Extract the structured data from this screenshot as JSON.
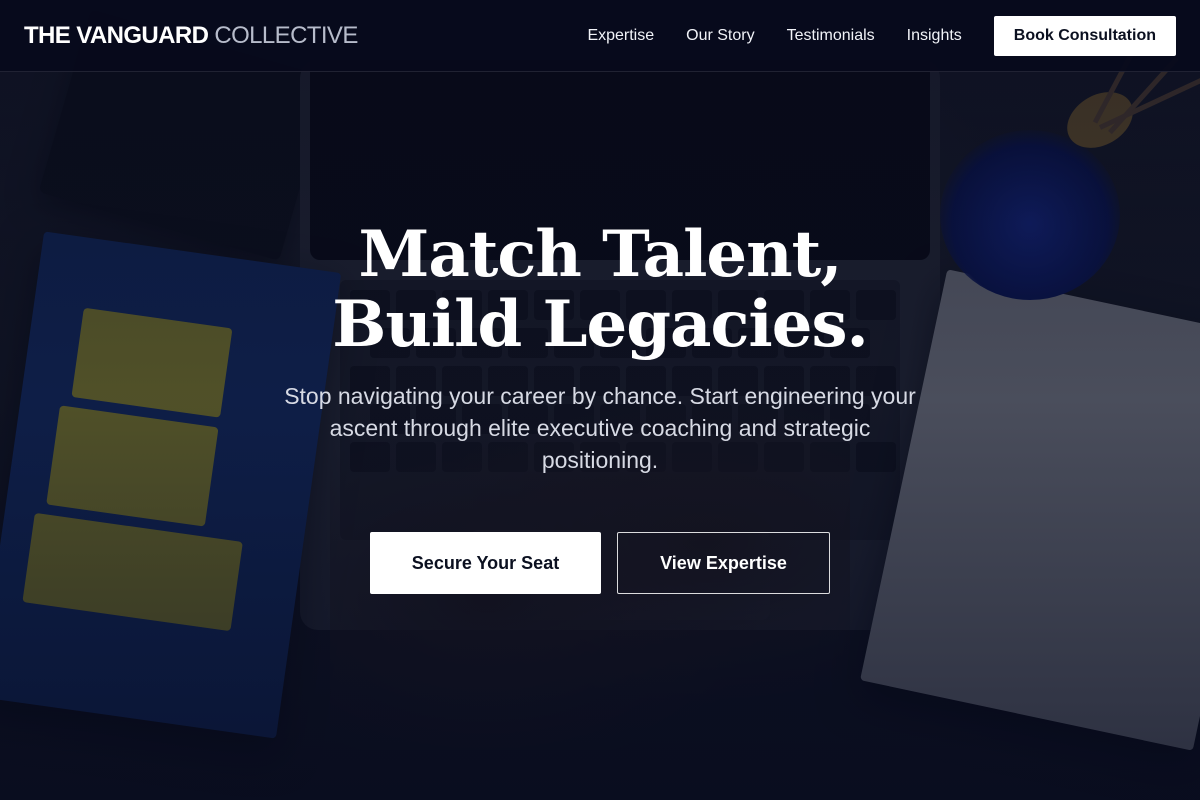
{
  "brand": {
    "name_strong": "THE VANGUARD",
    "name_light": "COLLECTIVE"
  },
  "nav": {
    "links": [
      "Expertise",
      "Our Story",
      "Testimonials",
      "Insights"
    ],
    "cta": "Book Consultation"
  },
  "hero": {
    "title_line1": "Match Talent,",
    "title_line2": "Build Legacies.",
    "subtitle": "Stop navigating your career by chance. Start engineering your ascent through elite executive coaching and strategic positioning.",
    "primary_cta": "Secure Your Seat",
    "secondary_cta": "View Expertise"
  },
  "colors": {
    "nav_bg": "#070a1c",
    "overlay": "#060a1e",
    "button_bg": "#ffffff",
    "button_text": "#0b1020"
  }
}
